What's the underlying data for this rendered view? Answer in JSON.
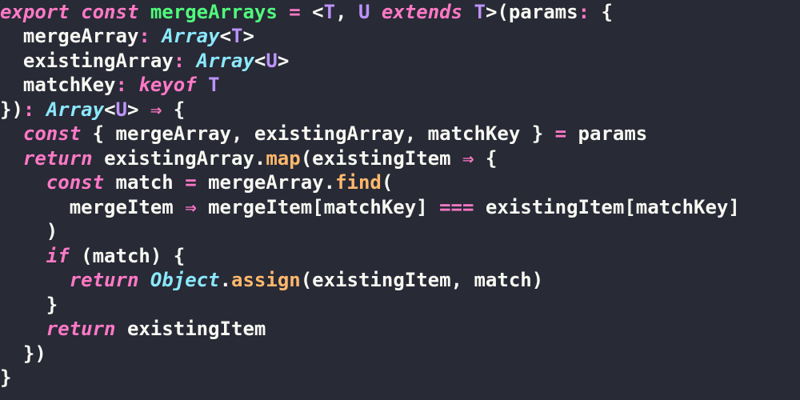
{
  "code": {
    "keywords": {
      "export": "export",
      "const": "const",
      "extends": "extends",
      "keyof": "keyof",
      "return": "return",
      "if": "if"
    },
    "identifiers": {
      "mergeArrays": "mergeArrays",
      "params": "params",
      "mergeArray": "mergeArray",
      "existingArray": "existingArray",
      "matchKey": "matchKey",
      "existingItem": "existingItem",
      "match": "match",
      "mergeItem": "mergeItem",
      "Object": "Object"
    },
    "types": {
      "Array": "Array",
      "T": "T",
      "U": "U"
    },
    "methods": {
      "map": "map",
      "find": "find",
      "assign": "assign"
    },
    "ops": {
      "eq": "=",
      "arrow": "⇒",
      "eqeqeq": "===",
      "lt": "<",
      "gt": ">",
      "comma": ",",
      "colon": ":",
      "dot": ".",
      "lparen": "(",
      "rparen": ")",
      "lbrace": "{",
      "rbrace": "}",
      "lbrack": "[",
      "rbrack": "]"
    }
  },
  "colors": {
    "bg": "#282a36",
    "fg": "#f8f8f2",
    "pink": "#ff79c6",
    "green": "#50fa7b",
    "cyan": "#8be9fd",
    "purple": "#bd93f9",
    "orange": "#ffb86c"
  }
}
